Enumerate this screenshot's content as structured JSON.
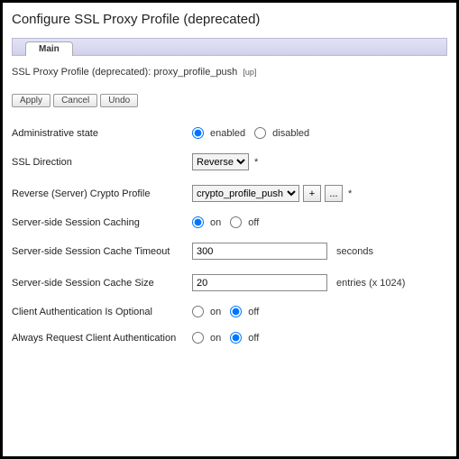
{
  "page": {
    "title": "Configure SSL Proxy Profile (deprecated)"
  },
  "tabs": {
    "main": "Main"
  },
  "breadcrumb": {
    "prefix": "SSL Proxy Profile (deprecated): ",
    "name": "proxy_profile_push",
    "up": "[up]"
  },
  "actions": {
    "apply": "Apply",
    "cancel": "Cancel",
    "undo": "Undo"
  },
  "form": {
    "admin_state": {
      "label": "Administrative state",
      "enabled": "enabled",
      "disabled": "disabled"
    },
    "ssl_direction": {
      "label": "SSL Direction",
      "value": "Reverse",
      "req": "*"
    },
    "reverse_profile": {
      "label": "Reverse (Server) Crypto Profile",
      "value": "crypto_profile_push",
      "plus": "+",
      "more": "...",
      "req": "*"
    },
    "ss_cache": {
      "label": "Server-side Session Caching",
      "on": "on",
      "off": "off"
    },
    "ss_cache_timeout": {
      "label": "Server-side Session Cache Timeout",
      "value": "300",
      "suffix": "seconds"
    },
    "ss_cache_size": {
      "label": "Server-side Session Cache Size",
      "value": "20",
      "suffix": "entries (x 1024)"
    },
    "client_auth_opt": {
      "label": "Client Authentication Is Optional",
      "on": "on",
      "off": "off"
    },
    "always_req_auth": {
      "label": "Always Request Client Authentication",
      "on": "on",
      "off": "off"
    }
  }
}
